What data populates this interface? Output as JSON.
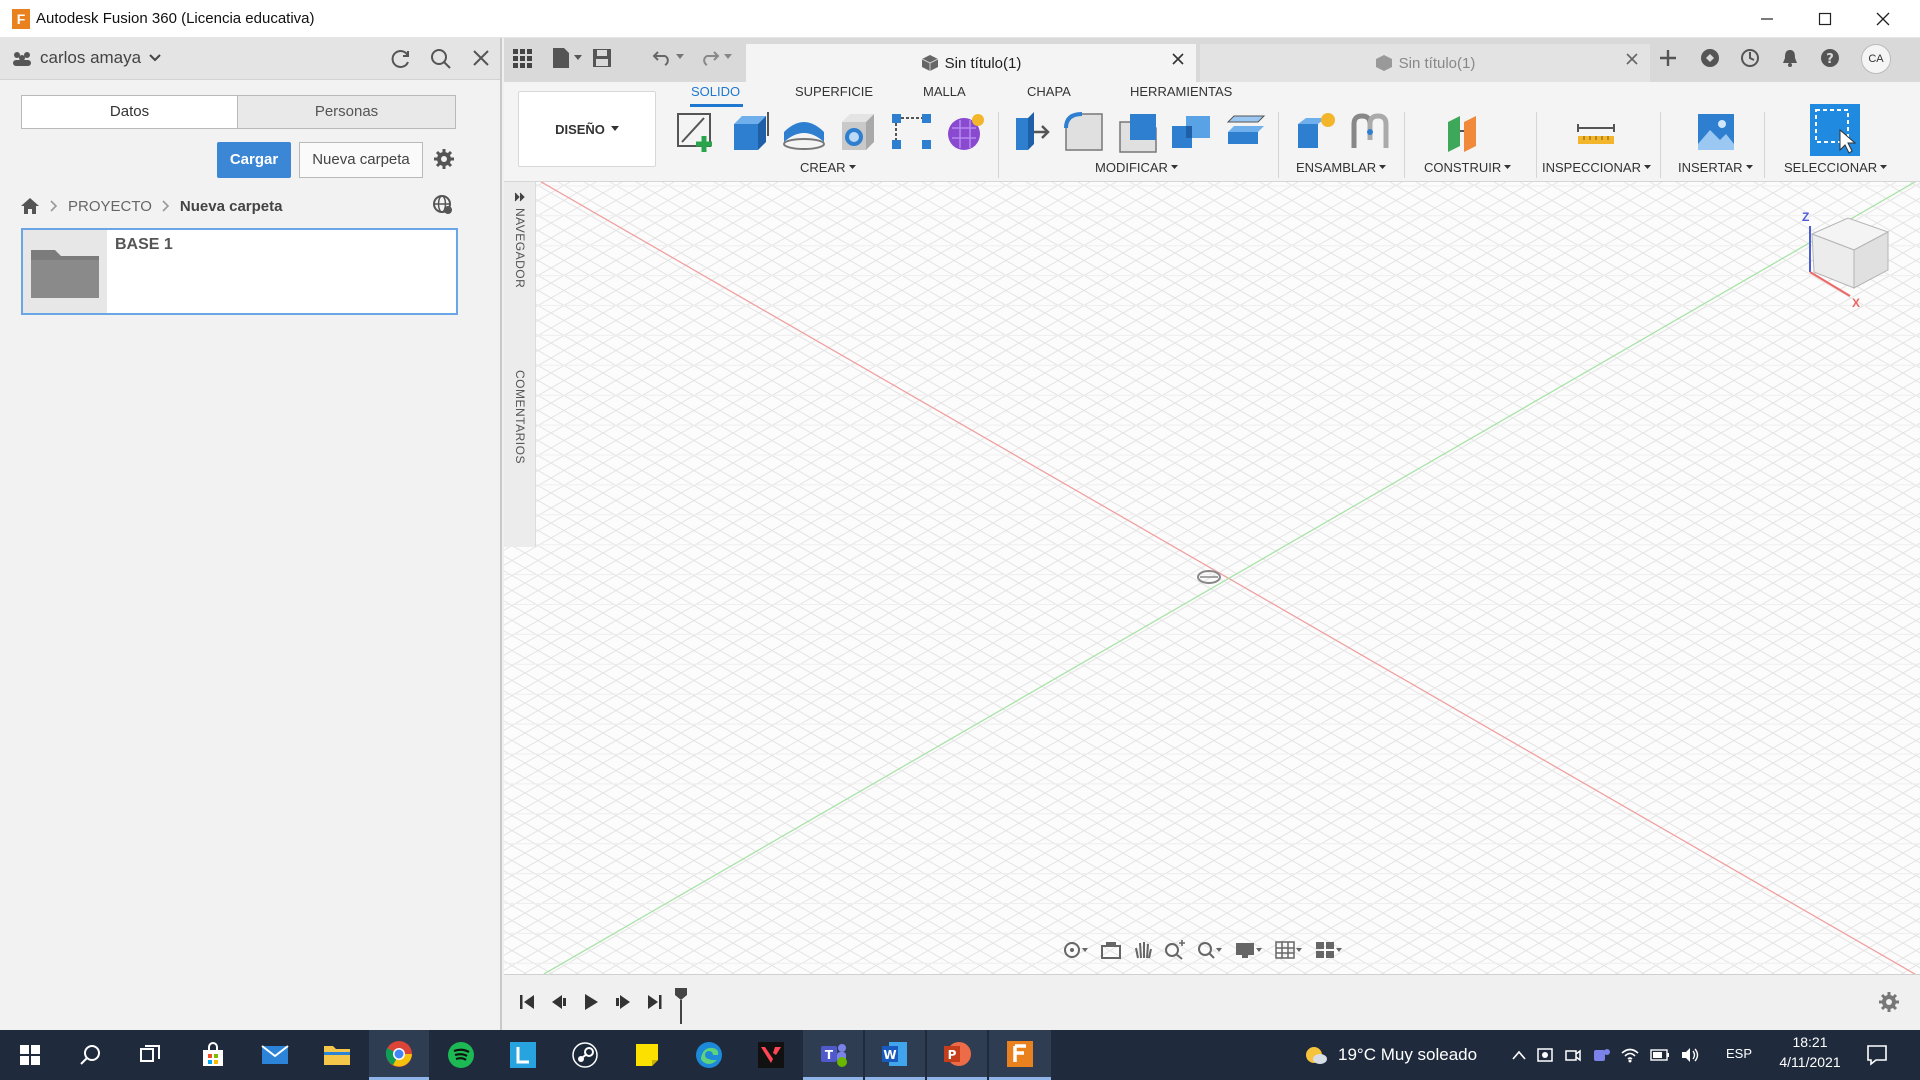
{
  "window": {
    "title": "Autodesk Fusion 360 (Licencia educativa)",
    "logo_letter": "F"
  },
  "data_panel": {
    "user_name": "carlos amaya",
    "tabs": [
      "Datos",
      "Personas"
    ],
    "upload_label": "Cargar",
    "new_folder_label": "Nueva carpeta",
    "breadcrumb": [
      "PROYECTO",
      "Nueva carpeta"
    ],
    "items": [
      {
        "name": "BASE 1"
      }
    ]
  },
  "documents": {
    "active_tab": "Sin título(1)",
    "inactive_tab": "Sin título(1)",
    "user_initials": "CA"
  },
  "ribbon": {
    "workspace": "DISEÑO",
    "tabs": [
      "SOLIDO",
      "SUPERFICIE",
      "MALLA",
      "CHAPA",
      "HERRAMIENTAS"
    ],
    "active_tab": "SOLIDO",
    "groups": [
      "CREAR",
      "MODIFICAR",
      "ENSAMBLAR",
      "CONSTRUIR",
      "INSPECCIONAR",
      "INSERTAR",
      "SELECCIONAR"
    ]
  },
  "side_labels": {
    "navigator": "NAVEGADOR",
    "comments": "COMENTARIOS"
  },
  "viewcube": {
    "z_label": "Z",
    "x_label": "X"
  },
  "taskbar": {
    "weather": "19°C  Muy soleado",
    "language": "ESP",
    "time": "18:21",
    "date": "4/11/2021"
  },
  "colors": {
    "accent": "#3b87d5",
    "x_axis": "#e87c7c",
    "y_axis": "#8fdc8f",
    "taskbar": "#1f2b3d",
    "fusion_orange": "#e8811e"
  }
}
